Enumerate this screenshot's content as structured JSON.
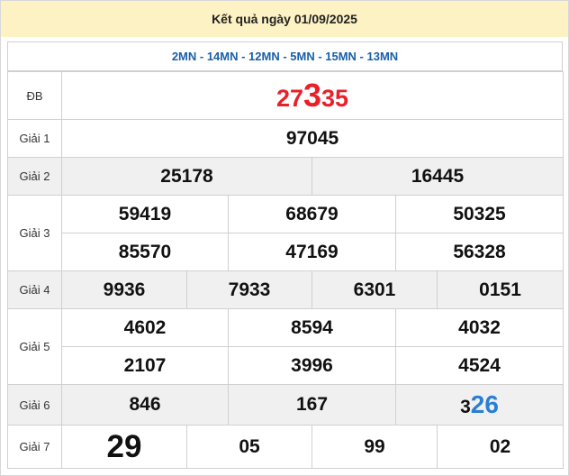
{
  "header": {
    "title": "Kết quả ngày 01/09/2025"
  },
  "codes": "2MN - 14MN - 12MN - 5MN - 15MN - 13MN",
  "labels": {
    "db": "ĐB",
    "g1": "Giải 1",
    "g2": "Giải 2",
    "g3": "Giải 3",
    "g4": "Giải 4",
    "g5": "Giải 5",
    "g6": "Giải 6",
    "g7": "Giải 7"
  },
  "results": {
    "db": {
      "prefix": "27",
      "highlight": "3",
      "suffix": "35"
    },
    "g1": [
      "97045"
    ],
    "g2": [
      "25178",
      "16445"
    ],
    "g3": [
      "59419",
      "68679",
      "50325",
      "85570",
      "47169",
      "56328"
    ],
    "g4": [
      "9936",
      "7933",
      "6301",
      "0151"
    ],
    "g5": [
      "4602",
      "8594",
      "4032",
      "2107",
      "3996",
      "4524"
    ],
    "g6": [
      "846",
      "167",
      {
        "prefix": "3",
        "highlight": "26"
      }
    ],
    "g7": [
      "29",
      "05",
      "99",
      "02"
    ]
  },
  "colors": {
    "header_bg": "#fdf2c4",
    "codes_text": "#1a5fa8",
    "red": "#e8202a",
    "blue": "#2a7fd4",
    "shade": "#f0f0f0"
  }
}
